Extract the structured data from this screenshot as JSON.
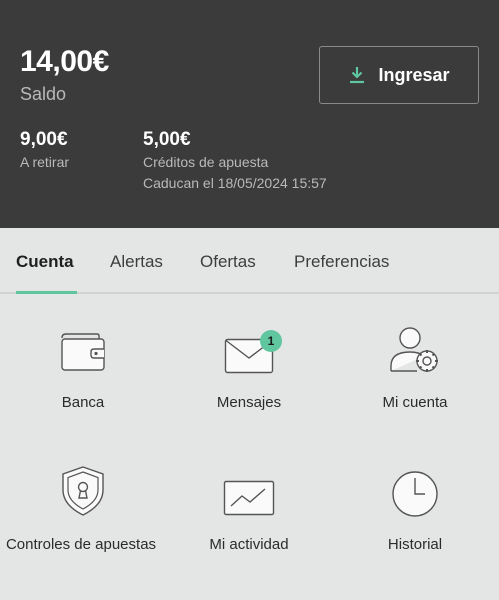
{
  "header": {
    "balance": "14,00€",
    "balance_label": "Saldo",
    "deposit_button": "Ingresar",
    "withdrawable": {
      "amount": "9,00€",
      "label": "A retirar"
    },
    "bet_credits": {
      "amount": "5,00€",
      "label": "Créditos de apuesta",
      "expiry": "Caducan el 18/05/2024 15:57"
    }
  },
  "tabs": [
    {
      "label": "Cuenta",
      "active": true
    },
    {
      "label": "Alertas",
      "active": false
    },
    {
      "label": "Ofertas",
      "active": false
    },
    {
      "label": "Preferencias",
      "active": false
    }
  ],
  "tiles": [
    {
      "label": "Banca",
      "icon": "wallet-icon"
    },
    {
      "label": "Mensajes",
      "icon": "envelope-icon",
      "badge": "1"
    },
    {
      "label": "Mi cuenta",
      "icon": "user-settings-icon"
    },
    {
      "label": "Controles de apuestas",
      "icon": "shield-lock-icon"
    },
    {
      "label": "Mi actividad",
      "icon": "activity-chart-icon"
    },
    {
      "label": "Historial",
      "icon": "clock-icon"
    }
  ],
  "colors": {
    "header_bg": "#3b3b3b",
    "accent": "#5fc6a0",
    "page_bg": "#e4e6e5"
  }
}
